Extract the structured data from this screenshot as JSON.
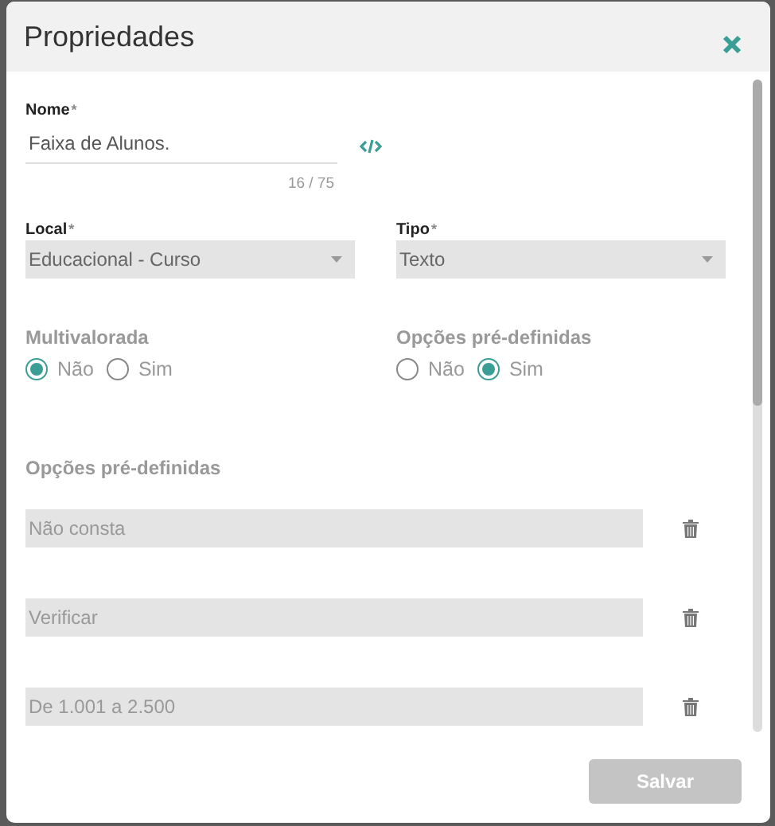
{
  "dialog": {
    "title": "Propriedades"
  },
  "name_field": {
    "label": "Nome",
    "required_mark": "*",
    "value": "Faixa de Alunos.",
    "counter": "16 / 75"
  },
  "selects": [
    {
      "label": "Local",
      "required_mark": "*",
      "value": "Educacional - Curso"
    },
    {
      "label": "Tipo",
      "required_mark": "*",
      "value": "Texto"
    }
  ],
  "radio_groups": [
    {
      "label": "Multivalorada",
      "options": [
        {
          "label": "Não",
          "selected": true
        },
        {
          "label": "Sim",
          "selected": false
        }
      ]
    },
    {
      "label": "Opções pré-definidas",
      "options": [
        {
          "label": "Não",
          "selected": false
        },
        {
          "label": "Sim",
          "selected": true
        }
      ]
    }
  ],
  "options_section": {
    "title": "Opções pré-definidas",
    "items": [
      {
        "placeholder": "Não consta"
      },
      {
        "placeholder": "Verificar"
      },
      {
        "placeholder": "De 1.001 a 2.500"
      }
    ]
  },
  "save_button": {
    "label": "Salvar",
    "disabled": true
  }
}
